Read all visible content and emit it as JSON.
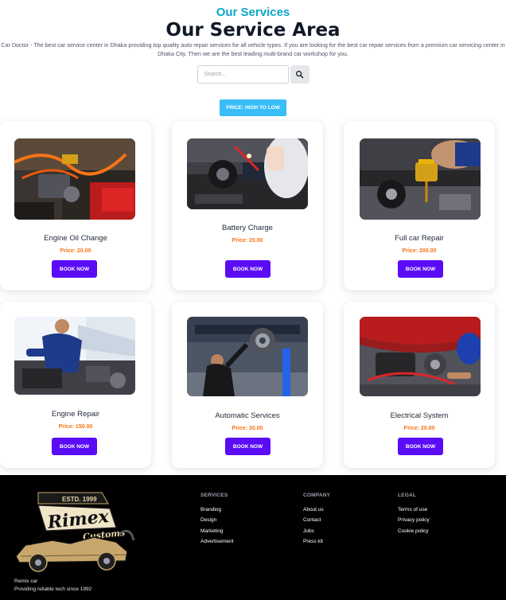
{
  "header": {
    "eyebrow": "Our Services",
    "title": "Our Service Area",
    "description": "Car Doctor - The best car service center in Dhaka providing top quality auto repair services for all vehicle types. If you are looking for the best car repair services from a premium car servicing center in Dhaka City. Then we are the best leading multi-brand car workshop for you."
  },
  "search": {
    "placeholder": "Search...",
    "value": ""
  },
  "sort_label": "PRICE: HIGH TO LOW",
  "services": [
    {
      "name": "Engine Oil Change",
      "price": "Price: 20.00",
      "button": "BOOK NOW"
    },
    {
      "name": "Battery Charge",
      "price": "Price: 20.00",
      "button": "BOOK NOW"
    },
    {
      "name": "Full car Repair",
      "price": "Price: 200.00",
      "button": "BOOK NOW"
    },
    {
      "name": "Engine Repair",
      "price": "Price: 150.00",
      "button": "BOOK NOW"
    },
    {
      "name": "Automatic Services",
      "price": "Price: 30.00",
      "button": "BOOK NOW"
    },
    {
      "name": "Electrical System",
      "price": "Price: 20.00",
      "button": "BOOK NOW"
    }
  ],
  "footer": {
    "brand_name": "Remix car",
    "brand_tagline": "Providing reliable tech since 1992",
    "logo_text": {
      "estd": "ESTD. 1999",
      "name": "Rimex",
      "sub": "Customs"
    },
    "columns": [
      {
        "title": "SERVICES",
        "links": [
          "Branding",
          "Design",
          "Marketing",
          "Advertisement"
        ]
      },
      {
        "title": "COMPANY",
        "links": [
          "About us",
          "Contact",
          "Jobs",
          "Press kit"
        ]
      },
      {
        "title": "LEGAL",
        "links": [
          "Terms of use",
          "Privacy policy",
          "Cookie policy"
        ]
      }
    ]
  },
  "colors": {
    "accent": "#0ea5c9",
    "sort_button": "#38bdf8",
    "book_button": "#5b0cf6",
    "price": "#f97316",
    "footer_bg": "#000000"
  }
}
